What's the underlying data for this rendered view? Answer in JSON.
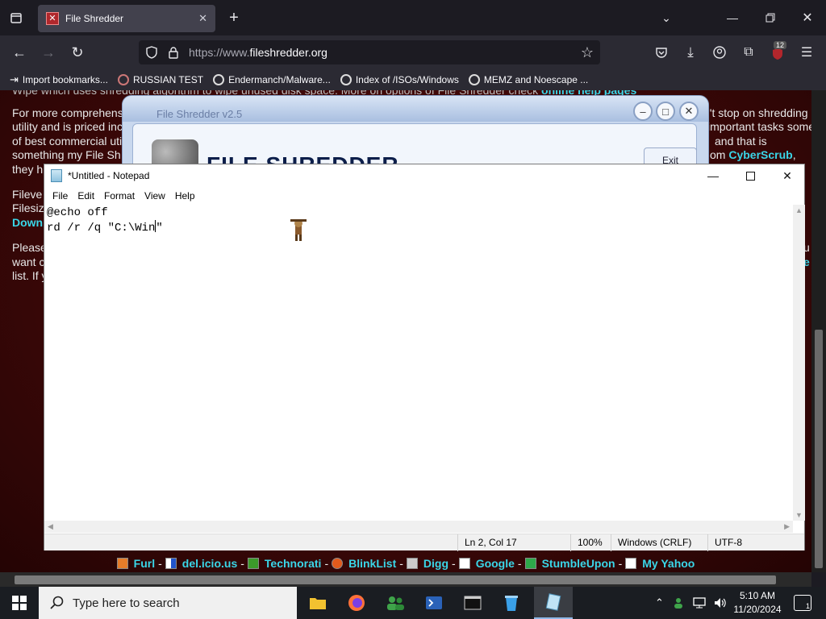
{
  "browser": {
    "tab_title": "File Shredder",
    "url_protocol": "https://www.",
    "url_domain": "fileshredder.org",
    "extensions_badge": "12",
    "bookmarks": [
      {
        "label": "Import bookmarks...",
        "icon": "import-icon"
      },
      {
        "label": "RUSSIAN TEST",
        "icon": "globe-icon"
      },
      {
        "label": "Endermanch/Malware...",
        "icon": "google-icon"
      },
      {
        "label": "Index of /ISOs/Windows",
        "icon": "google-icon"
      },
      {
        "label": "MEMZ and Noescape ...",
        "icon": "globe-icon"
      }
    ]
  },
  "page": {
    "lines": [
      {
        "pre": "For more comprehens",
        "post": "n't stop on shredding"
      },
      {
        "pre": "utility and is priced inc",
        "post": "important tasks some"
      },
      {
        "pre": "of best commercial uti",
        "post": "and that is"
      },
      {
        "pre": "something my File Sh",
        "post": "om ",
        "link": "CyberScrub",
        "tail": ","
      },
      {
        "pre": "they h",
        "post": ""
      }
    ],
    "lines2": [
      {
        "pre": "Fileve"
      },
      {
        "pre": "Filesiz"
      },
      {
        "link": "Down"
      }
    ],
    "lines3": [
      {
        "pre": "Please",
        "post": "u"
      },
      {
        "pre": "want c",
        "link": "e"
      },
      {
        "pre": "list. If y"
      }
    ],
    "top_partial": "Wipe which uses shredding algorithm to wipe unused disk space. More on options of File Shredder check",
    "top_link": "online help pages",
    "social": [
      {
        "label": "Furl"
      },
      {
        "label": "del.icio.us"
      },
      {
        "label": "Technorati"
      },
      {
        "label": "BlinkList"
      },
      {
        "label": "Digg"
      },
      {
        "label": "Google"
      },
      {
        "label": "StumbleUpon"
      },
      {
        "label": "My Yahoo"
      }
    ],
    "separator": "-"
  },
  "file_shredder": {
    "title": "File Shredder v2.5",
    "banner": "FILE SHREDDER",
    "exit_label": "Exit"
  },
  "notepad": {
    "title": "*Untitled - Notepad",
    "menu": [
      "File",
      "Edit",
      "Format",
      "View",
      "Help"
    ],
    "line1": "@echo off",
    "line2_before": "rd /r /q \"C:\\Win",
    "line2_after": "\"",
    "status": {
      "position": "Ln 2, Col 17",
      "zoom": "100%",
      "line_endings": "Windows (CRLF)",
      "encoding": "UTF-8"
    }
  },
  "taskbar": {
    "search_placeholder": "Type here to search",
    "time": "5:10 AM",
    "date": "11/20/2024",
    "notification_count": "1"
  }
}
